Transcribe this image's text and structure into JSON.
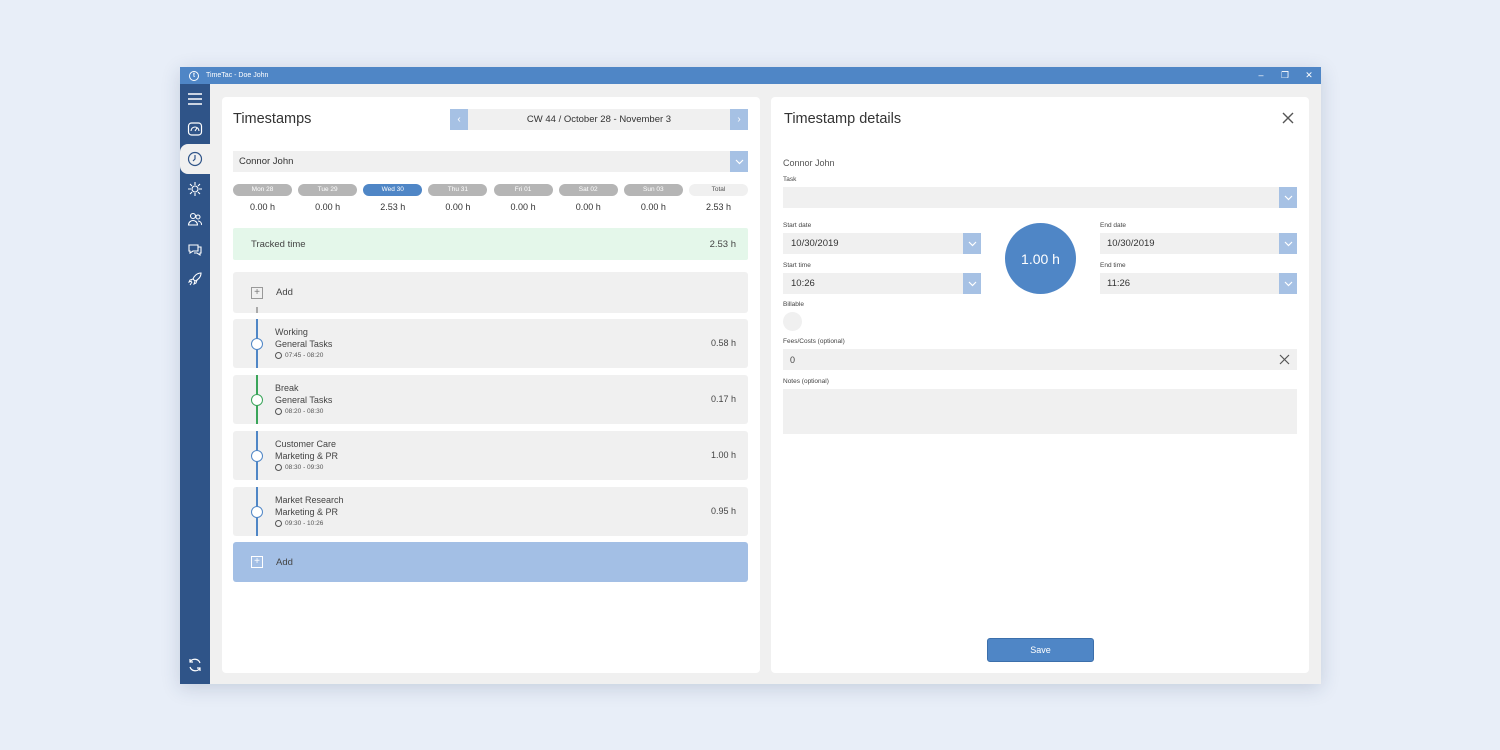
{
  "window": {
    "title": "TimeTac - Doe John",
    "controls": {
      "minimize": "–",
      "restore": "❐",
      "close": "✕"
    }
  },
  "sidebar": {
    "items": [
      "menu-icon",
      "dashboard-icon",
      "clock-icon",
      "sun-icon",
      "users-icon",
      "chat-icon",
      "rocket-icon"
    ],
    "bottom": "sync-icon"
  },
  "timestamps": {
    "title": "Timestamps",
    "week_label": "CW 44 / October 28 - November 3",
    "prev": "‹",
    "next": "›",
    "user": "Connor John",
    "days": [
      {
        "label": "Mon 28",
        "hours": "0.00 h"
      },
      {
        "label": "Tue 29",
        "hours": "0.00 h"
      },
      {
        "label": "Wed 30",
        "hours": "2.53 h",
        "active": true
      },
      {
        "label": "Thu 31",
        "hours": "0.00 h"
      },
      {
        "label": "Fri 01",
        "hours": "0.00 h"
      },
      {
        "label": "Sat 02",
        "hours": "0.00 h"
      },
      {
        "label": "Sun 03",
        "hours": "0.00 h"
      },
      {
        "label": "Total",
        "hours": "2.53 h",
        "total": true
      }
    ],
    "tracked_label": "Tracked time",
    "tracked_value": "2.53 h",
    "add_label": "Add",
    "entries": [
      {
        "name": "Working",
        "category": "General Tasks",
        "time": "07:45 - 08:20",
        "duration": "0.58 h",
        "color": "#4f86c6"
      },
      {
        "name": "Break",
        "category": "General Tasks",
        "time": "08:20 - 08:30",
        "duration": "0.17 h",
        "color": "#3aa55a"
      },
      {
        "name": "Customer Care",
        "category": "Marketing & PR",
        "time": "08:30 - 09:30",
        "duration": "1.00 h",
        "color": "#4f86c6"
      },
      {
        "name": "Market Research",
        "category": "Marketing & PR",
        "time": "09:30 - 10:26",
        "duration": "0.95 h",
        "color": "#4f86c6"
      }
    ]
  },
  "details": {
    "title": "Timestamp details",
    "user": "Connor John",
    "task_label": "Task",
    "task_value": "",
    "start_date_label": "Start date",
    "start_date": "10/30/2019",
    "start_time_label": "Start time",
    "start_time": "10:26",
    "end_date_label": "End date",
    "end_date": "10/30/2019",
    "end_time_label": "End time",
    "end_time": "11:26",
    "duration": "1.00 h",
    "billable_label": "Billable",
    "fees_label": "Fees/Costs (optional)",
    "fees_value": "0",
    "notes_label": "Notes (optional)",
    "save_label": "Save"
  }
}
